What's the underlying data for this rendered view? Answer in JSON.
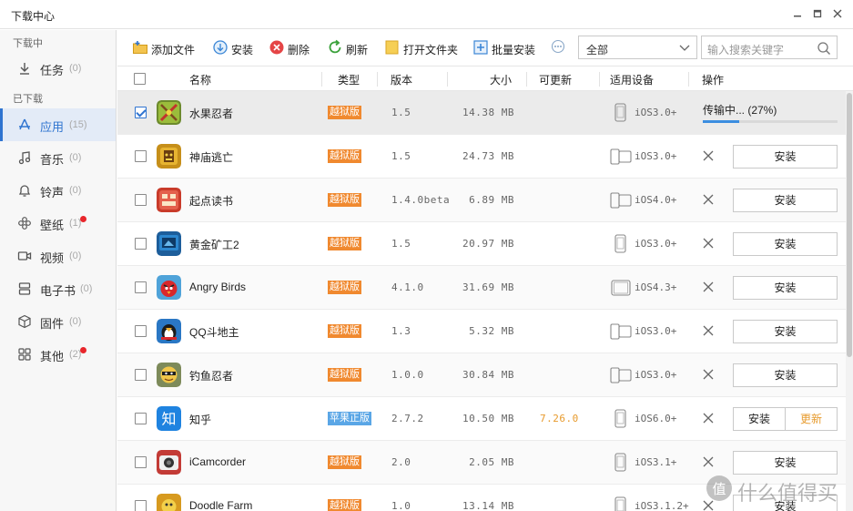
{
  "window": {
    "title": "下载中心"
  },
  "sidebar": {
    "downloading_label": "下载中",
    "downloaded_label": "已下载",
    "items": [
      {
        "label": "任务",
        "count": "(0)",
        "icon": "download-icon",
        "dot": false
      },
      {
        "label": "应用",
        "count": "(15)",
        "icon": "app-store-icon",
        "dot": false,
        "active": true
      },
      {
        "label": "音乐",
        "count": "(0)",
        "icon": "music-note-icon",
        "dot": false
      },
      {
        "label": "铃声",
        "count": "(0)",
        "icon": "bell-icon",
        "dot": false
      },
      {
        "label": "壁纸",
        "count": "(1)",
        "icon": "flower-icon",
        "dot": true
      },
      {
        "label": "视频",
        "count": "(0)",
        "icon": "video-camera-icon",
        "dot": false
      },
      {
        "label": "电子书",
        "count": "(0)",
        "icon": "book-icon",
        "dot": false
      },
      {
        "label": "固件",
        "count": "(0)",
        "icon": "cube-icon",
        "dot": false
      },
      {
        "label": "其他",
        "count": "(2)",
        "icon": "grid-icon",
        "dot": true
      }
    ]
  },
  "toolbar": {
    "add_file": "添加文件",
    "install": "安装",
    "delete": "删除",
    "refresh": "刷新",
    "open_folder": "打开文件夹",
    "batch_install": "批量安装",
    "filter_value": "全部",
    "search_placeholder": "输入搜索关键字"
  },
  "table": {
    "headers": {
      "name": "名称",
      "type": "类型",
      "version": "版本",
      "size": "大小",
      "updatable": "可更新",
      "device": "适用设备",
      "action": "操作"
    },
    "rows": [
      {
        "name": "水果忍者",
        "type": "越狱版",
        "version": "1.5",
        "size": "14.38 MB",
        "update": "",
        "device": "iOS3.0+",
        "device_kind": "phone",
        "checked": true,
        "status": "传输中... (27%)",
        "progress": 0.27
      },
      {
        "name": "神庙逃亡",
        "type": "越狱版",
        "version": "1.5",
        "size": "24.73 MB",
        "update": "",
        "device": "iOS3.0+",
        "device_kind": "both",
        "checked": false,
        "button": "安装"
      },
      {
        "name": "起点读书",
        "type": "越狱版",
        "version": "1.4.0beta",
        "size": "6.89 MB",
        "update": "",
        "device": "iOS4.0+",
        "device_kind": "both",
        "checked": false,
        "button": "安装"
      },
      {
        "name": "黄金矿工2",
        "type": "越狱版",
        "version": "1.5",
        "size": "20.97 MB",
        "update": "",
        "device": "iOS3.0+",
        "device_kind": "phone",
        "checked": false,
        "button": "安装"
      },
      {
        "name": "Angry Birds",
        "type": "越狱版",
        "version": "4.1.0",
        "size": "31.69 MB",
        "update": "",
        "device": "iOS4.3+",
        "device_kind": "tablet",
        "checked": false,
        "button": "安装"
      },
      {
        "name": "QQ斗地主",
        "type": "越狱版",
        "version": "1.3",
        "size": "5.32 MB",
        "update": "",
        "device": "iOS3.0+",
        "device_kind": "both",
        "checked": false,
        "button": "安装"
      },
      {
        "name": "钓鱼忍者",
        "type": "越狱版",
        "version": "1.0.0",
        "size": "30.84 MB",
        "update": "",
        "device": "iOS3.0+",
        "device_kind": "both",
        "checked": false,
        "button": "安装"
      },
      {
        "name": "知乎",
        "type": "苹果正版",
        "version": "2.7.2",
        "size": "10.50 MB",
        "update": "7.26.0",
        "device": "iOS6.0+",
        "device_kind": "phone",
        "checked": false,
        "button": "安装",
        "button2": "更新"
      },
      {
        "name": "iCamcorder",
        "type": "越狱版",
        "version": "2.0",
        "size": "2.05 MB",
        "update": "",
        "device": "iOS3.1+",
        "device_kind": "phone",
        "checked": false,
        "button": "安装"
      },
      {
        "name": "Doodle Farm",
        "type": "越狱版",
        "version": "1.0",
        "size": "13.14 MB",
        "update": "",
        "device": "iOS3.1.2+",
        "device_kind": "phone",
        "checked": false,
        "button": "安装"
      }
    ]
  },
  "watermark": {
    "text": "值 什么值得买"
  },
  "colors": {
    "accent": "#2f74d0",
    "jailbreak_badge": "#f0892f",
    "official_badge": "#5aa6e6",
    "update_text": "#e79a2c"
  }
}
